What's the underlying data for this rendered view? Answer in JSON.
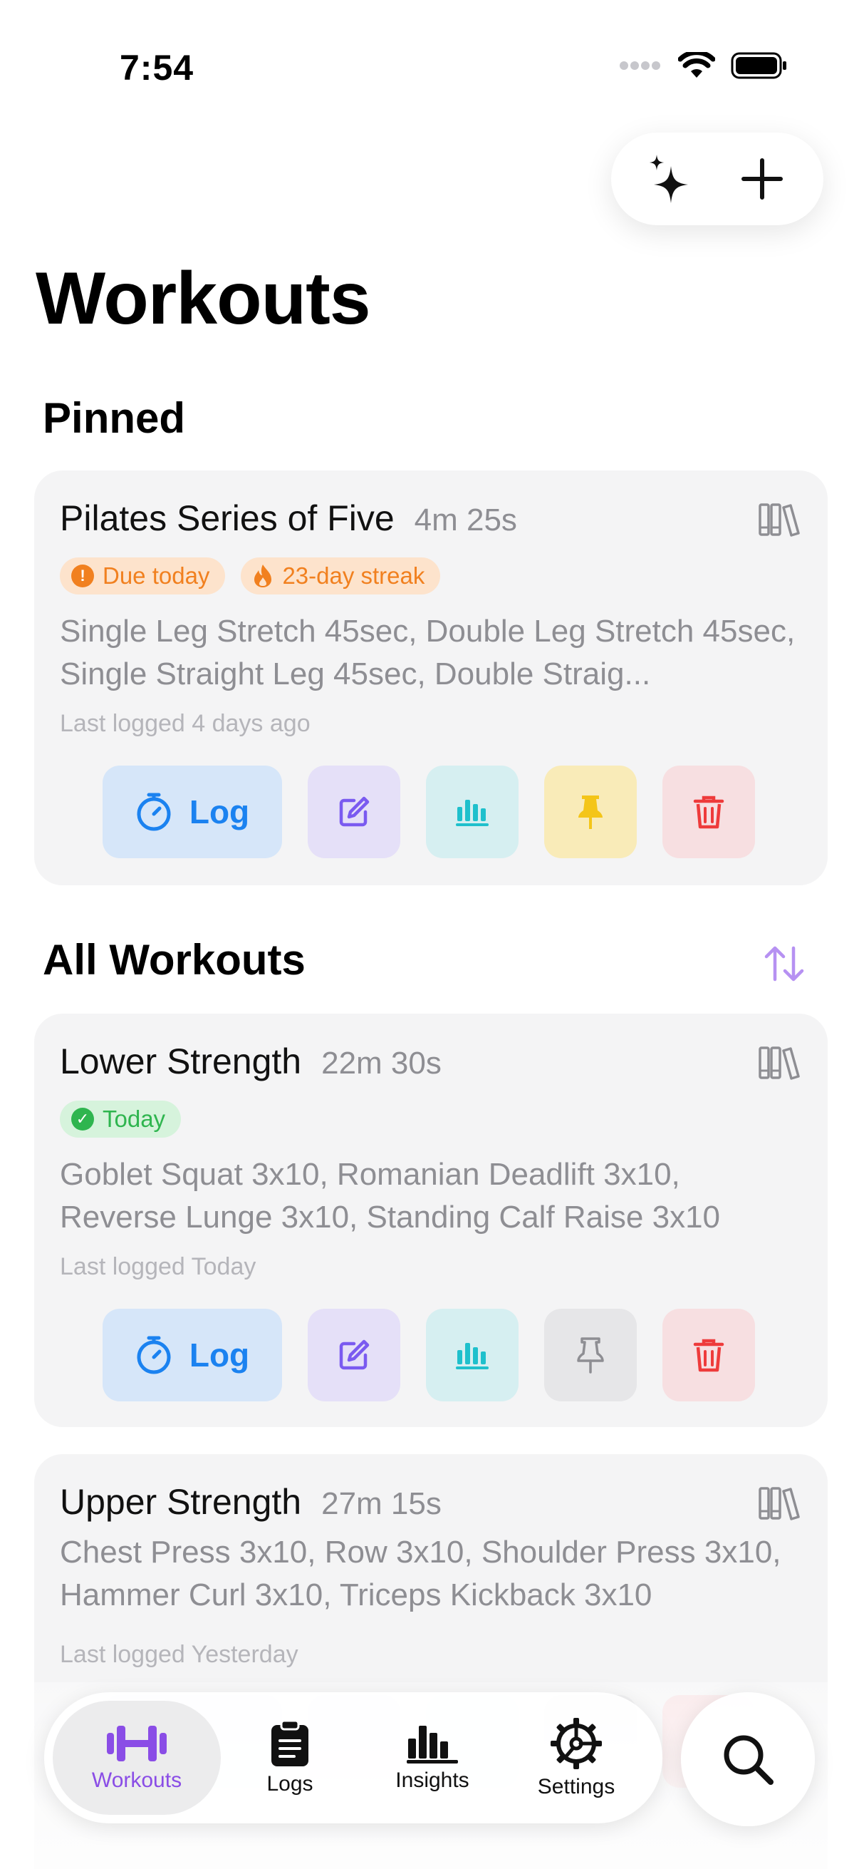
{
  "status": {
    "time": "7:54"
  },
  "page": {
    "title": "Workouts"
  },
  "sections": {
    "pinned": "Pinned",
    "all": "All Workouts"
  },
  "pinned_card": {
    "name": "Pilates Series of Five",
    "duration": "4m 25s",
    "badges": [
      "Due today",
      "23-day streak"
    ],
    "description": "Single Leg Stretch 45sec, Double Leg Stretch 45sec, Single Straight Leg 45sec, Double Straig...",
    "last_logged": "Last logged 4 days ago",
    "log_label": "Log"
  },
  "workouts": [
    {
      "name": "Lower Strength",
      "duration": "22m 30s",
      "badges": [
        "Today"
      ],
      "description": "Goblet Squat 3x10, Romanian Deadlift 3x10, Reverse Lunge 3x10, Standing Calf Raise 3x10",
      "last_logged": "Last logged Today",
      "log_label": "Log"
    },
    {
      "name": "Upper Strength",
      "duration": "27m 15s",
      "description": "Chest Press 3x10, Row 3x10, Shoulder Press 3x10, Hammer Curl 3x10, Triceps Kickback 3x10",
      "last_logged": "Last logged Yesterday"
    }
  ],
  "tabs": [
    {
      "label": "Workouts",
      "icon": "dumbbell-icon",
      "active": true
    },
    {
      "label": "Logs",
      "icon": "clipboard-icon"
    },
    {
      "label": "Insights",
      "icon": "bar-chart-icon"
    },
    {
      "label": "Settings",
      "icon": "gear-icon"
    }
  ],
  "colors": {
    "accent_purple": "#8a4de6",
    "log_blue": "#1b82f0",
    "edit_purple": "#7a5af0",
    "stats_teal": "#1fc0cc",
    "pin_yellow": "#f4c518",
    "delete_red": "#ee3b3b",
    "badge_orange": "#f1801f",
    "badge_green": "#2fb54f"
  }
}
